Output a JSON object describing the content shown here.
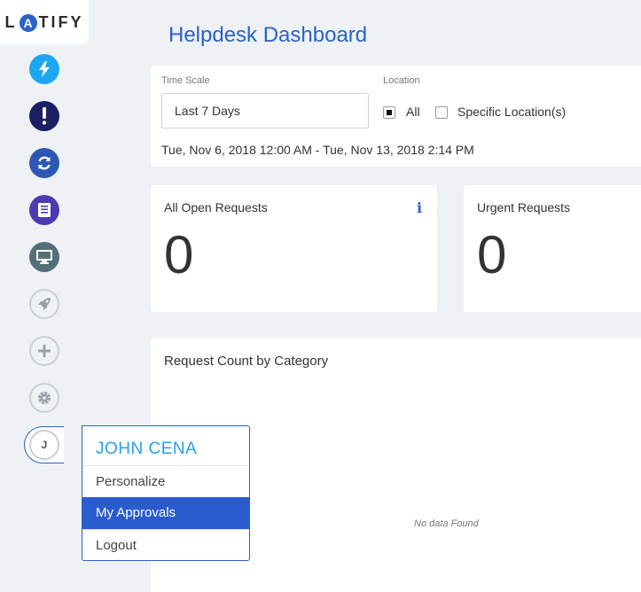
{
  "logo": {
    "text_pre": "L",
    "text_a": "A",
    "text_post": "TIFY"
  },
  "sidebar": {
    "icons": [
      "bolt-icon",
      "alert-icon",
      "sync-icon",
      "book-icon",
      "monitor-icon",
      "rocket-icon",
      "plus-icon",
      "gear-icon"
    ],
    "avatar_initial": "J"
  },
  "header": {
    "title": "Helpdesk Dashboard"
  },
  "filters": {
    "time_scale_label": "Time Scale",
    "time_scale_value": "Last 7 Days",
    "location_label": "Location",
    "location_all": "All",
    "location_specific": "Specific Location(s)",
    "date_range": "Tue, Nov 6, 2018 12:00 AM - Tue, Nov 13, 2018 2:14 PM"
  },
  "cards": {
    "open": {
      "title": "All Open Requests",
      "value": "0",
      "info": "i"
    },
    "urgent": {
      "title": "Urgent Requests",
      "value": "0"
    },
    "category": {
      "title": "Request Count by Category",
      "empty": "No data Found"
    }
  },
  "user_menu": {
    "name": "JOHN CENA",
    "items": [
      "Personalize",
      "My Approvals",
      "Logout"
    ],
    "selected": "My Approvals"
  },
  "colors": {
    "accent": "#2a62c9",
    "highlight": "#2a5ccd",
    "name": "#2a9de6"
  }
}
